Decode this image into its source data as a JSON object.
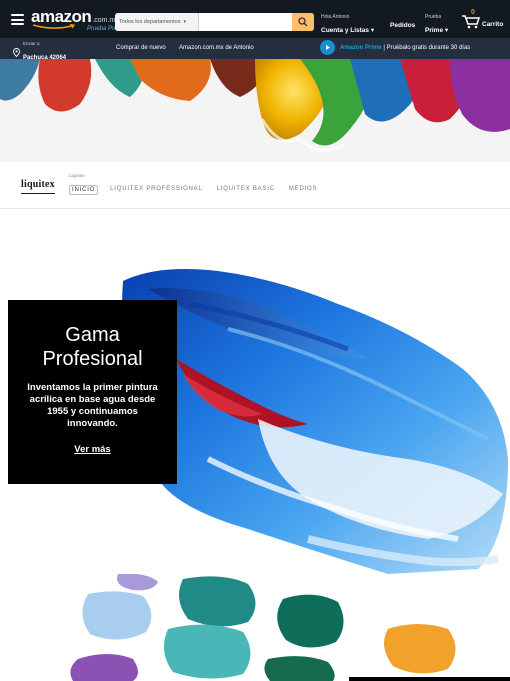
{
  "header": {
    "logo_text": "amazon",
    "logo_tld": ".com.mx",
    "logo_prime": "Prueba Prime",
    "search": {
      "department": "Todos los departamentos",
      "placeholder": "",
      "value": ""
    },
    "account": {
      "greeting": "Hola Antonio",
      "label": "Cuenta y Listas"
    },
    "orders": "Pedidos",
    "prime": {
      "greeting": "Prueba",
      "label": "Prime"
    },
    "cart": {
      "count": "0",
      "label": "Carrito"
    }
  },
  "subnav": {
    "deliver": {
      "label": "Enviar a",
      "location": "Pachuca 42064"
    },
    "links": [
      "Comprar de nuevo",
      "Amazon.com.mx de Antonio"
    ],
    "promo": {
      "brand": "Amazon Prime",
      "text": " | Pruébalo gratis durante 30 días"
    }
  },
  "brand_nav": {
    "logo": "liquitex",
    "tag": "Liquitex",
    "tabs": [
      {
        "label": "INICIO",
        "active": true
      },
      {
        "label": "LIQUITEX PROFESSIONAL",
        "active": false
      },
      {
        "label": "LIQUITEX BASIC",
        "active": false
      },
      {
        "label": "MEDIOS",
        "active": false
      }
    ]
  },
  "hero": {
    "title_line1": "Gama",
    "title_line2": "Profesional",
    "description": "Inventamos la primer pintura acrílica en base agua desde 1955 y continuamos innovando.",
    "link": "Ver más"
  },
  "colors": {
    "nav_top": "#131921",
    "nav_bottom": "#232f3e",
    "search_button": "#febd69",
    "prime_blue": "#1b8ccf",
    "cart_orange": "#f08804",
    "hero_card": "#000000"
  },
  "icons": {
    "menu": "hamburger-icon",
    "search": "search-icon",
    "location": "location-pin-icon",
    "cart": "cart-icon",
    "play": "play-icon"
  }
}
